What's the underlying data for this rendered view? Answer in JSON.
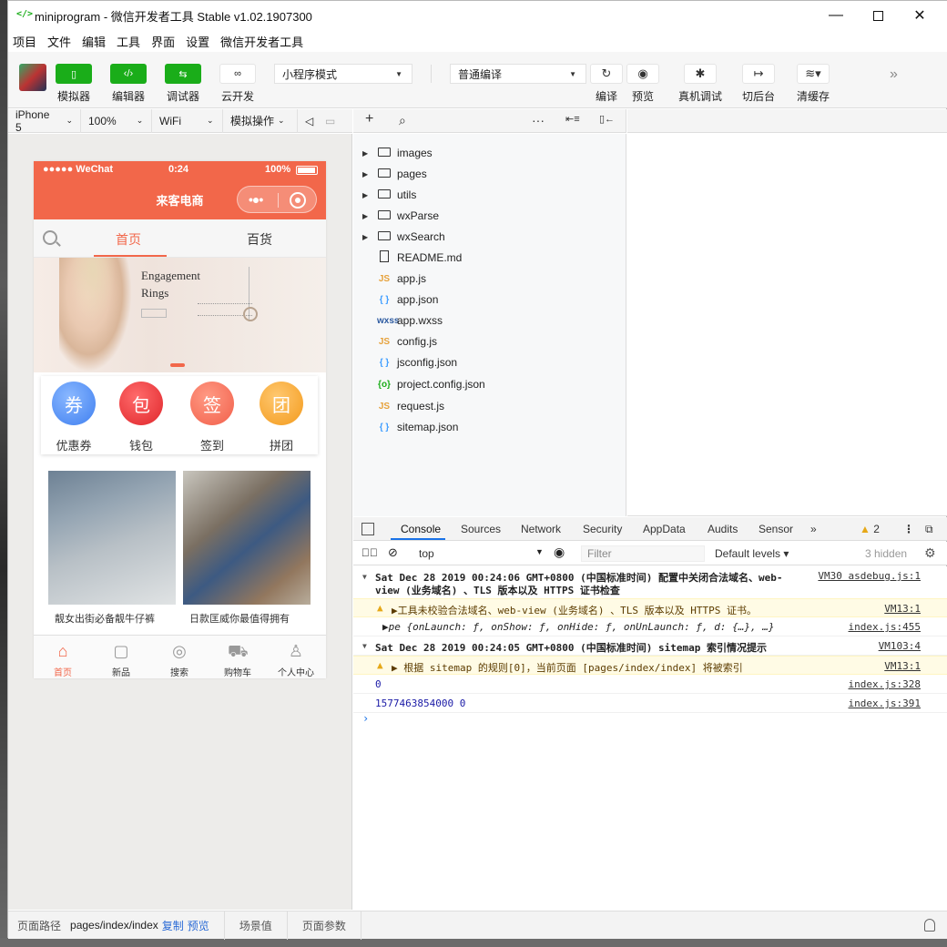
{
  "window": {
    "title": "miniprogram - 微信开发者工具 Stable v1.02.1907300",
    "app_icon": "</>"
  },
  "menu": [
    "项目",
    "文件",
    "编辑",
    "工具",
    "界面",
    "设置",
    "微信开发者工具"
  ],
  "toolbar": {
    "simulator": "模拟器",
    "editor": "编辑器",
    "debugger": "调试器",
    "cloud": "云开发",
    "mode": "小程序模式",
    "compile_mode": "普通编译",
    "compile": "编译",
    "preview": "预览",
    "remote_debug": "真机调试",
    "backend": "切后台",
    "clear_cache": "清缓存",
    "sim_icon": "phone-icon",
    "editor_icon": "code-icon",
    "debugger_icon": "swap-icon",
    "cloud_icon": "link-icon"
  },
  "sim_bar": {
    "device": "iPhone 5",
    "zoom": "100%",
    "network": "WiFi",
    "operation": "模拟操作"
  },
  "phone": {
    "signal": "●●●●● WeChat",
    "time": "0:24",
    "battery": "100%",
    "nav_title": "来客电商",
    "tabs": [
      "首页",
      "百货"
    ],
    "banner_headline": "Engagement Rings",
    "icons": [
      {
        "glyph": "券",
        "label": "优惠券"
      },
      {
        "glyph": "包",
        "label": "钱包"
      },
      {
        "glyph": "签",
        "label": "签到"
      },
      {
        "glyph": "团",
        "label": "拼团"
      }
    ],
    "products": [
      {
        "title": "靓女出街必备靓牛仔裤"
      },
      {
        "title": "日款匡威你最值得拥有"
      }
    ],
    "tabbar": [
      {
        "label": "首页",
        "icon": "home-icon"
      },
      {
        "label": "新品",
        "icon": "bag-icon"
      },
      {
        "label": "搜索",
        "icon": "search-icon"
      },
      {
        "label": "购物车",
        "icon": "cart-icon"
      },
      {
        "label": "个人中心",
        "icon": "person-icon"
      }
    ]
  },
  "explorer": {
    "files": [
      {
        "name": "images",
        "type": "folder"
      },
      {
        "name": "pages",
        "type": "folder"
      },
      {
        "name": "utils",
        "type": "folder"
      },
      {
        "name": "wxParse",
        "type": "folder"
      },
      {
        "name": "wxSearch",
        "type": "folder"
      },
      {
        "name": "README.md",
        "type": "md"
      },
      {
        "name": "app.js",
        "type": "js"
      },
      {
        "name": "app.json",
        "type": "json"
      },
      {
        "name": "app.wxss",
        "type": "wxss"
      },
      {
        "name": "config.js",
        "type": "js"
      },
      {
        "name": "jsconfig.json",
        "type": "json"
      },
      {
        "name": "project.config.json",
        "type": "cfg"
      },
      {
        "name": "request.js",
        "type": "js"
      },
      {
        "name": "sitemap.json",
        "type": "json"
      }
    ]
  },
  "devtools": {
    "tabs": [
      "Console",
      "Sources",
      "Network",
      "Security",
      "AppData",
      "Audits",
      "Sensor"
    ],
    "warn_count": "2",
    "context": "top",
    "filter_placeholder": "Filter",
    "levels": "Default levels",
    "hidden": "3 hidden"
  },
  "console": {
    "logs": [
      {
        "text": "Sat Dec 28 2019 00:24:06 GMT+0800 (中国标准时间) 配置中关闭合法域名、web-",
        "text2": "view (业务域名) 、TLS 版本以及 HTTPS 证书检查",
        "src": "VM30 asdebug.js:1"
      },
      {
        "text": "▶工具未校验合法域名、web-view (业务域名) 、TLS 版本以及 HTTPS 证书。",
        "src": "VM13:1"
      },
      {
        "text": "▶pe {onLaunch: ƒ, onShow: ƒ, onHide: ƒ, onUnLaunch: ƒ, d: {…}, …}",
        "src": "index.js:455"
      },
      {
        "text": "Sat Dec 28 2019 00:24:05 GMT+0800 (中国标准时间) sitemap 索引情况提示",
        "src": "VM103:4"
      },
      {
        "text": "▶ 根据 sitemap 的规则[0]，当前页面 [pages/index/index] 将被索引",
        "src": "VM13:1"
      },
      {
        "text": "0",
        "src": "index.js:328"
      },
      {
        "text": "1577463854000 0",
        "src": "index.js:391"
      }
    ]
  },
  "footer": {
    "path_label": "页面路径",
    "path": "pages/index/index",
    "copy": "复制",
    "preview": "预览",
    "scene": "场景值",
    "params": "页面参数"
  }
}
